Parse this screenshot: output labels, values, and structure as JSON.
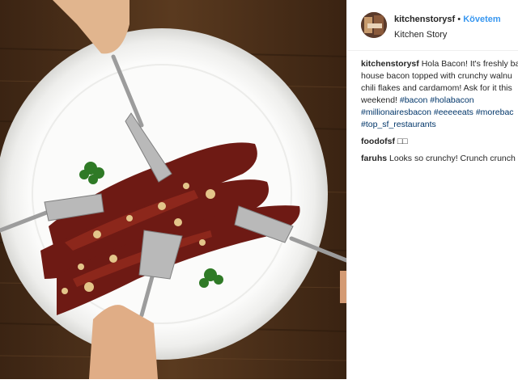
{
  "post": {
    "username": "kitchenstorysf",
    "follow_label": "Követem",
    "dot": "•",
    "subtitle": "Kitchen Story"
  },
  "caption": {
    "username": "kitchenstorysf",
    "line1": "Hola Bacon! It's freshly ba",
    "line2": "house bacon topped with crunchy walnu",
    "line3": "chili flakes and cardamom! Ask for it this",
    "line4_prefix": "weekend! ",
    "tags_line4": "#bacon #holabacon",
    "tags_line5": "#millionairesbacon #eeeeeats #morebac",
    "tags_line6": "#top_sf_restaurants"
  },
  "comments": [
    {
      "username": "foodofsf",
      "text": "□□"
    },
    {
      "username": "faruhs",
      "text": "Looks so crunchy! Crunch crunch"
    }
  ],
  "colors": {
    "link": "#3897f0",
    "hashtag": "#003569",
    "text": "#262626"
  },
  "icons": [
    "avatar-image",
    "bacon-photo"
  ]
}
